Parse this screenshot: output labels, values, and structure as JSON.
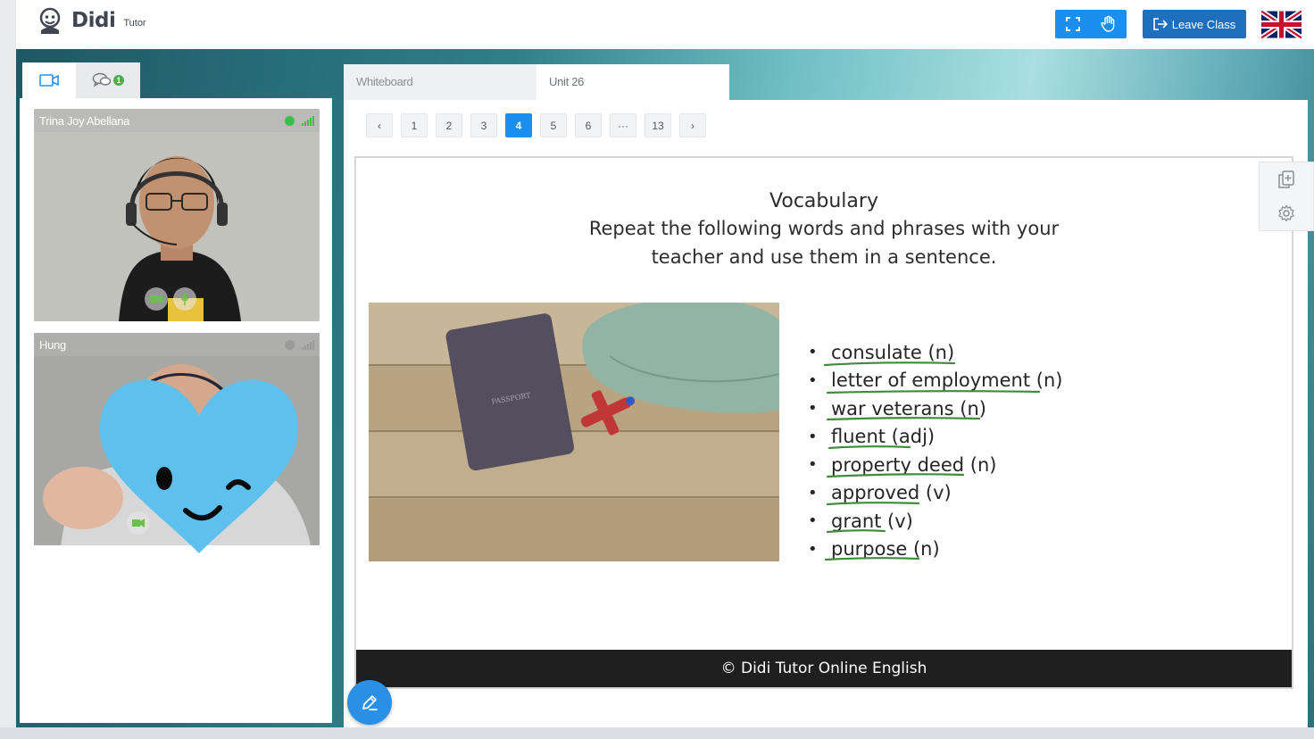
{
  "app": {
    "logo_name": "Didi",
    "logo_sub": "Tutor"
  },
  "toolbar": {
    "fullscreen_icon": "fullscreen-icon",
    "raise_hand_icon": "hand-icon",
    "leave_label": "Leave Class",
    "language_flag": "uk-flag"
  },
  "video_panel": {
    "tabs": [
      {
        "icon": "video-camera-icon"
      },
      {
        "icon": "chat-icon",
        "badge": "1"
      }
    ],
    "participants": [
      {
        "name": "Trina Joy Abellana",
        "status_color": "#3bbf4a"
      },
      {
        "name": "Hung",
        "status_color": "#9a9a9a"
      }
    ]
  },
  "main": {
    "tabs": [
      {
        "label": "Whiteboard"
      },
      {
        "label": "Unit 26"
      }
    ],
    "pagination": {
      "prev": "‹",
      "pages": [
        "1",
        "2",
        "3",
        "4",
        "5",
        "6",
        "···",
        "13"
      ],
      "current": "4",
      "next": "›"
    },
    "slide": {
      "title": "Vocabulary",
      "instruction_line1": "Repeat the following words and phrases with your",
      "instruction_line2": "teacher and use them in a sentence.",
      "vocabulary": [
        "consulate (n)",
        "letter of employment (n)",
        "war veterans (n)",
        "fluent (adj)",
        "property deed (n)",
        "approved (v)",
        "grant (v)",
        "purpose (n)"
      ],
      "footer": "© Didi Tutor Online English"
    },
    "side_tools": [
      "copy-icon",
      "settings-icon"
    ],
    "pen_tool": "pen-icon"
  }
}
